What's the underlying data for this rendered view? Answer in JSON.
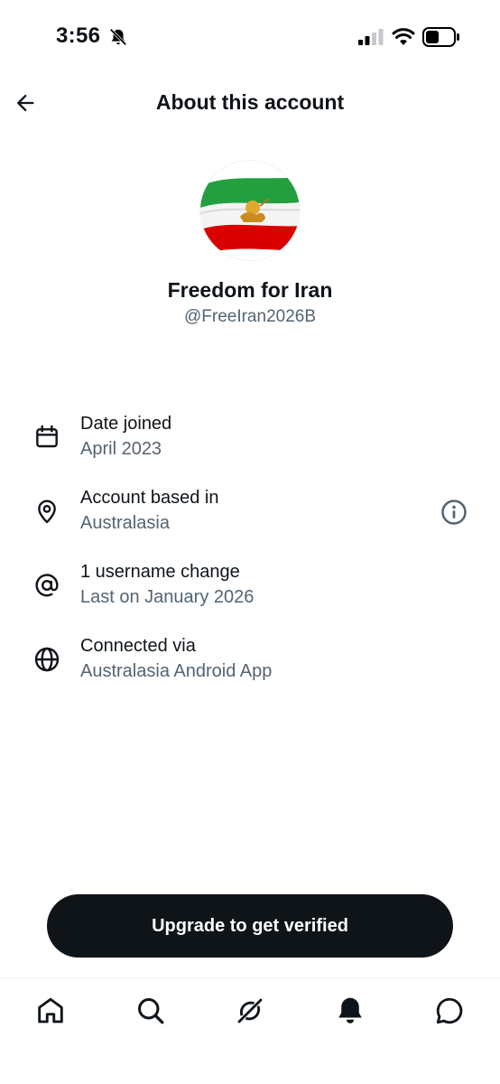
{
  "status_bar": {
    "time": "3:56",
    "icons": [
      "bell-off-icon",
      "cellular-signal-icon",
      "wifi-icon",
      "battery-icon"
    ]
  },
  "header": {
    "title": "About this account",
    "back_icon": "arrow-left-icon"
  },
  "profile": {
    "display_name": "Freedom for Iran",
    "handle": "@FreeIran2026B",
    "avatar": "lion-and-sun-flag-avatar"
  },
  "info_rows": [
    {
      "icon": "calendar-icon",
      "title": "Date joined",
      "value": "April 2023"
    },
    {
      "icon": "location-pin-icon",
      "title": "Account based in",
      "value": "Australasia",
      "action_icon": "info-icon"
    },
    {
      "icon": "at-sign-icon",
      "title": "1 username change",
      "value": "Last on January 2026"
    },
    {
      "icon": "globe-icon",
      "title": "Connected via",
      "value": "Australasia Android App"
    }
  ],
  "upgrade_button": {
    "label": "Upgrade to get verified"
  },
  "bottom_nav": {
    "items": [
      "home-icon",
      "search-icon",
      "grok-icon",
      "notifications-bell-icon",
      "messages-icon"
    ]
  },
  "colors": {
    "text_primary": "#0f1419",
    "text_secondary": "#536471",
    "button_bg": "#0f1419",
    "flag_green": "#239f40",
    "flag_red": "#da0000"
  }
}
